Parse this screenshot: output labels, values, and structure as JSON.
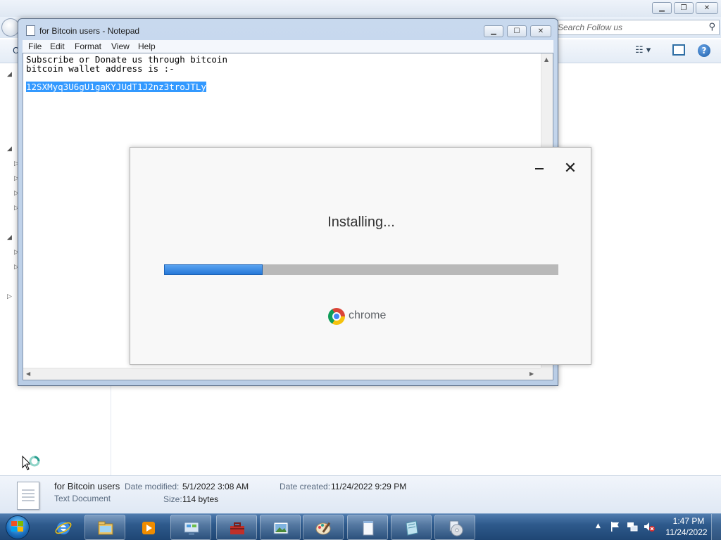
{
  "explorer": {
    "search_placeholder": "Search Follow us",
    "org_partial": "O",
    "details": {
      "file_name": "for Bitcoin users",
      "file_type": "Text Document",
      "date_modified_label": "Date modified:",
      "date_modified": "5/1/2022 3:08 AM",
      "date_created_label": "Date created:",
      "date_created": "11/24/2022 9:29 PM",
      "size_label": "Size:",
      "size": "114 bytes"
    }
  },
  "notepad": {
    "title": "for Bitcoin users - Notepad",
    "menu": [
      "File",
      "Edit",
      "Format",
      "View",
      "Help"
    ],
    "lines": [
      "Subscribe or Donate us through bitcoin",
      "bitcoin wallet address is :-"
    ],
    "selected_line": "12SXMyq3U6gU1gaKYJUdT1J2nz3troJTLy"
  },
  "installer": {
    "status": "Installing...",
    "progress": 0.25,
    "brand": "chrome",
    "progress_color": "#2678d8"
  },
  "taskbar": {
    "apps": [
      "internet-explorer-icon",
      "windows-explorer-icon",
      "media-player-icon",
      "control-panel-icon",
      "toolbox-icon",
      "photo-viewer-icon",
      "paint-icon",
      "notepad-icon",
      "wordpad-icon",
      "disc-installer-icon"
    ],
    "time": "1:47 PM",
    "date": "11/24/2022"
  }
}
